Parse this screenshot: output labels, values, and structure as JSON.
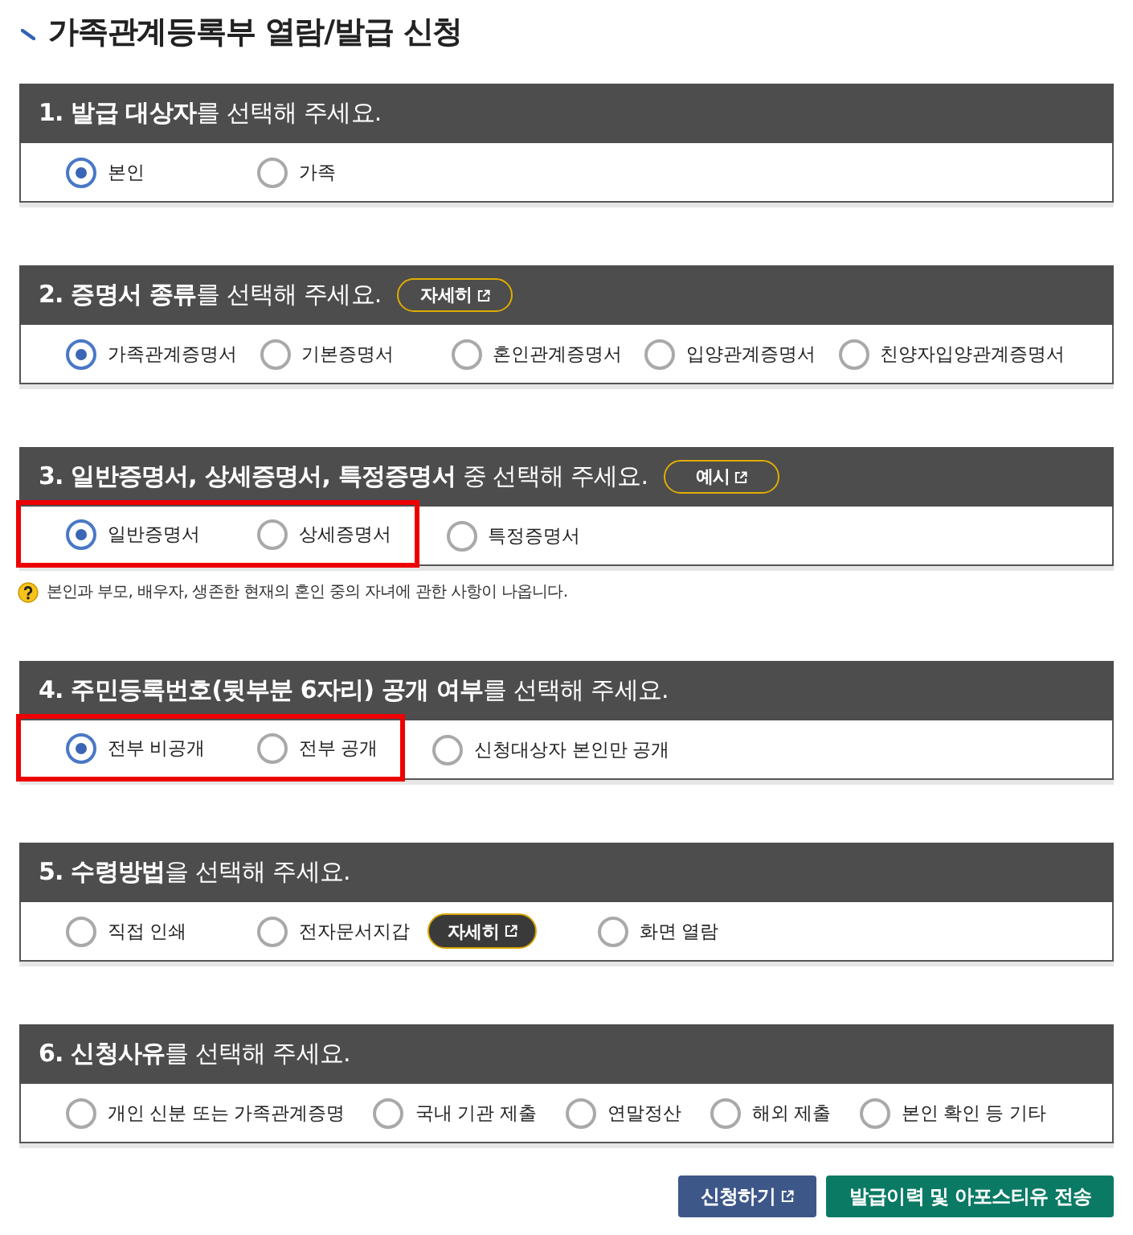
{
  "page": {
    "title": "가족관계등록부 열람/발급 신청"
  },
  "sections": [
    {
      "heading": "**1. 발급 대상자**를 선택해 주세요.",
      "options": [
        {
          "label": "본인",
          "selected": true
        },
        {
          "label": "가족",
          "selected": false
        }
      ]
    },
    {
      "heading": "**2. 증명서 종류**를 선택해 주세요.",
      "heading_button": {
        "label": "자세히",
        "external": true
      },
      "options": [
        {
          "label": "가족관계증명서",
          "selected": true
        },
        {
          "label": "기본증명서",
          "selected": false
        },
        {
          "label": "혼인관계증명서",
          "selected": false
        },
        {
          "label": "입양관계증명서",
          "selected": false
        },
        {
          "label": "친양자입양관계증명서",
          "selected": false
        }
      ]
    },
    {
      "heading": "**3. 일반증명서, 상세증명서, 특정증명서** 중 선택해 주세요.",
      "heading_button": {
        "label": "예시",
        "external": true
      },
      "options": [
        {
          "label": "일반증명서",
          "selected": true,
          "highlighted": true
        },
        {
          "label": "상세증명서",
          "selected": false,
          "highlighted": true
        },
        {
          "label": "특정증명서",
          "selected": false,
          "highlighted": false
        }
      ],
      "note": "본인과 부모, 배우자, 생존한 현재의 혼인 중의 자녀에 관한 사항이 나옵니다."
    },
    {
      "heading": "**4. 주민등록번호(뒷부분 6자리) 공개 여부**를 선택해 주세요.",
      "options": [
        {
          "label": "전부 비공개",
          "selected": true,
          "highlighted": true
        },
        {
          "label": "전부 공개",
          "selected": false,
          "highlighted": true
        },
        {
          "label": "신청대상자 본인만 공개",
          "selected": false,
          "highlighted": false
        }
      ]
    },
    {
      "heading": "**5. 수령방법**을 선택해 주세요.",
      "options": [
        {
          "label": "직접 인쇄",
          "selected": false
        },
        {
          "label": "전자문서지갑",
          "selected": false,
          "button": {
            "label": "자세히",
            "external": true
          }
        },
        {
          "label": "화면 열람",
          "selected": false
        }
      ]
    },
    {
      "heading": "**6. 신청사유**를 선택해 주세요.",
      "options": [
        {
          "label": "개인 신분 또는 가족관계증명",
          "selected": false
        },
        {
          "label": "국내 기관 제출",
          "selected": false
        },
        {
          "label": "연말정산",
          "selected": false
        },
        {
          "label": "해외 제출",
          "selected": false
        },
        {
          "label": "본인 확인 등 기타",
          "selected": false
        }
      ]
    }
  ],
  "actions": [
    {
      "label": "신청하기",
      "kind": "primary",
      "external": true
    },
    {
      "label": "발급이력 및 아포스티유 전송",
      "kind": "secondary",
      "external": false
    }
  ]
}
